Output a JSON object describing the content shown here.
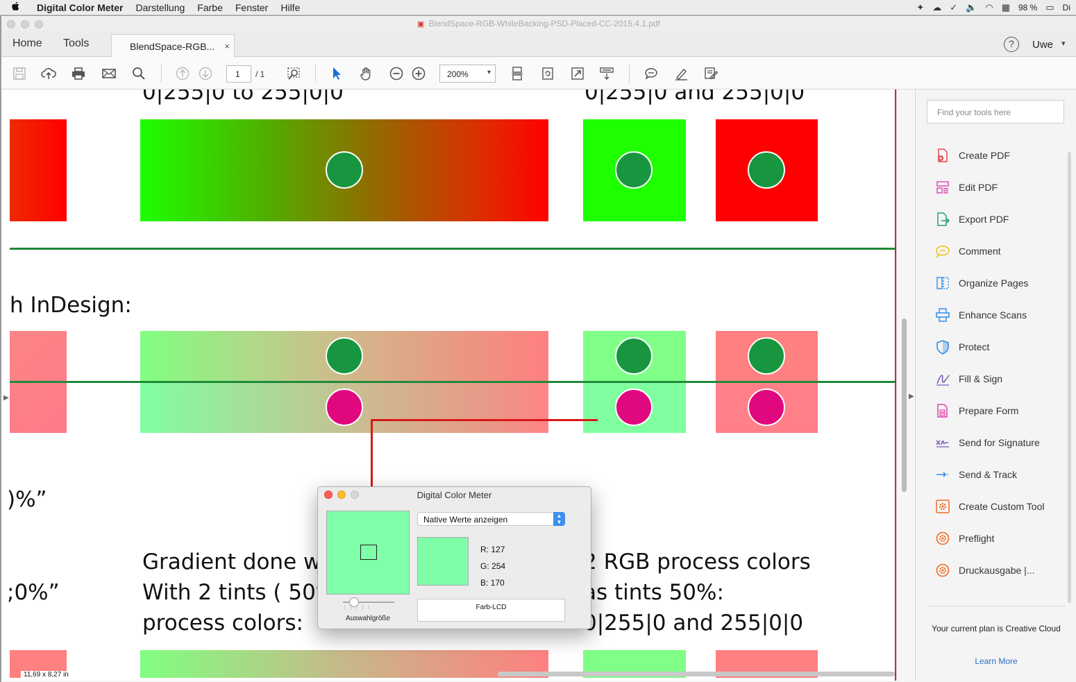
{
  "menubar": {
    "apple": "",
    "app_name": "Digital Color Meter",
    "items": [
      "Darstellung",
      "Farbe",
      "Fenster",
      "Hilfe"
    ],
    "battery": "98 %",
    "user_short": "Di"
  },
  "window": {
    "title": "BlendSpace-RGB-WhiteBacking-PSD-Placed-CC-2015.4.1.pdf"
  },
  "tabs": {
    "home": "Home",
    "tools": "Tools",
    "document": "BlendSpace-RGB...",
    "close": "×",
    "help": "?",
    "user": "Uwe",
    "user_chevron": "▾"
  },
  "toolbar": {
    "page_current": "1",
    "page_total": "/ 1",
    "zoom": "200%",
    "zoom_chevron": "▾"
  },
  "document": {
    "heading_top_left": "0|255|0 to 255|0|0",
    "heading_top_right": "0|255|0 and 255|0|0",
    "label_indesign": "h InDesign:",
    "label_percent_1": ")%”",
    "label_percent_2": ";0%”",
    "gradient_text_line1": "Gradient done w",
    "gradient_text_line2": "With 2 tints ( 50%",
    "gradient_text_line3": "process colors:",
    "right_text_line1": "2 RGB process colors",
    "right_text_line2": "as tints 50%:",
    "right_text_line3": "0|255|0 and 255|0|0",
    "page_size": "11,69 x 8,27 in",
    "colors": {
      "pure_green": "#1eff00",
      "pure_red": "#ff0000",
      "tint_green": "#80ff88",
      "tint_red": "#ff8080",
      "dot_green": "#17963f",
      "dot_magenta": "#e0087f",
      "divider_green": "#1f8a3c"
    }
  },
  "right_panel": {
    "search_placeholder": "Find your tools here",
    "tools": [
      {
        "label": "Create PDF",
        "icon": "create-pdf-icon",
        "color": "#e34850"
      },
      {
        "label": "Edit PDF",
        "icon": "edit-pdf-icon",
        "color": "#e040a8"
      },
      {
        "label": "Export PDF",
        "icon": "export-pdf-icon",
        "color": "#2d9d78"
      },
      {
        "label": "Comment",
        "icon": "comment-icon",
        "color": "#f0c419"
      },
      {
        "label": "Organize Pages",
        "icon": "organize-pages-icon",
        "color": "#2d8ceb"
      },
      {
        "label": "Enhance Scans",
        "icon": "enhance-scans-icon",
        "color": "#2d8ceb"
      },
      {
        "label": "Protect",
        "icon": "protect-icon",
        "color": "#2d8ceb"
      },
      {
        "label": "Fill & Sign",
        "icon": "fill-sign-icon",
        "color": "#7a5ebd"
      },
      {
        "label": "Prepare Form",
        "icon": "prepare-form-icon",
        "color": "#e040a8"
      },
      {
        "label": "Send for Signature",
        "icon": "send-signature-icon",
        "color": "#7a5ebd"
      },
      {
        "label": "Send & Track",
        "icon": "send-track-icon",
        "color": "#2d8ceb"
      },
      {
        "label": "Create Custom Tool",
        "icon": "custom-tool-icon",
        "color": "#f06a20"
      },
      {
        "label": "Preflight",
        "icon": "preflight-icon",
        "color": "#f06a20"
      },
      {
        "label": "Druckausgabe |...",
        "icon": "print-production-icon",
        "color": "#f06a20"
      }
    ],
    "plan_text": "Your current plan is Creative Cloud",
    "learn_more": "Learn More"
  },
  "color_meter": {
    "title": "Digital Color Meter",
    "mode": "Native Werte anzeigen",
    "r_label": "R:",
    "r_value": "127",
    "g_label": "G:",
    "g_value": "254",
    "b_label": "B:",
    "b_value": "170",
    "aperture_label": "Auswahlgröße",
    "display_profile": "Farb-LCD",
    "measured_color": "#7ffeaa"
  }
}
